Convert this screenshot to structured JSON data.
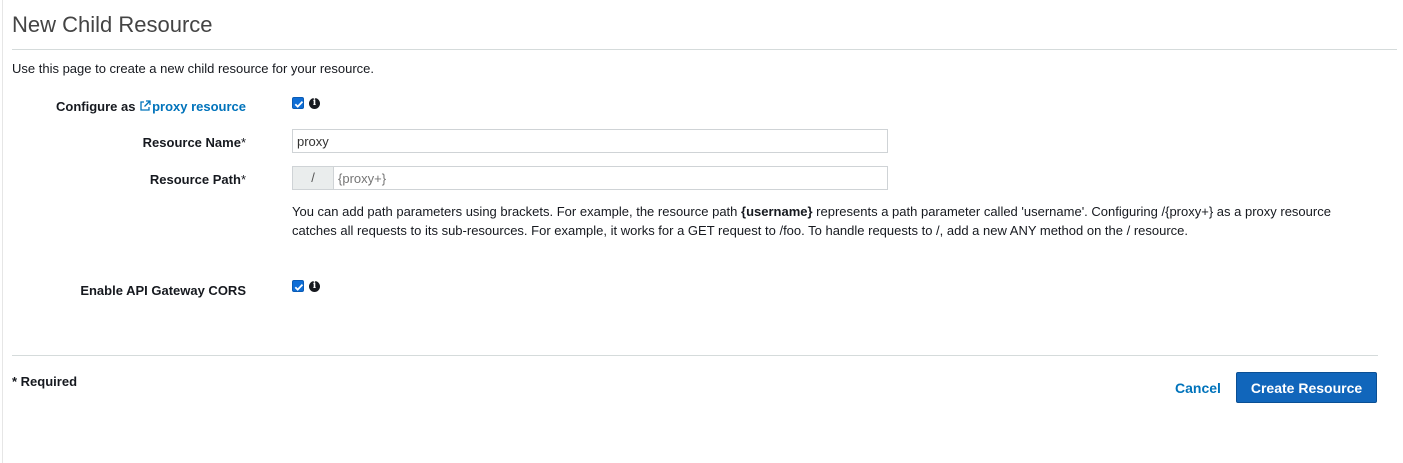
{
  "page": {
    "title": "New Child Resource",
    "intro": "Use this page to create a new child resource for your resource."
  },
  "form": {
    "proxy": {
      "label_prefix": "Configure as ",
      "link_text": "proxy resource",
      "checked": true
    },
    "resource_name": {
      "label": "Resource Name",
      "required_mark": "*",
      "value": "proxy"
    },
    "resource_path": {
      "label": "Resource Path",
      "required_mark": "*",
      "prefix": "/",
      "value": "{proxy+}"
    },
    "help": {
      "part1": "You can add path parameters using brackets. For example, the resource path ",
      "bold": "{username}",
      "part2": " represents a path parameter called 'username'. Configuring /{proxy+} as a proxy resource catches all requests to its sub-resources. For example, it works for a GET request to /foo. To handle requests to /, add a new ANY method on the / resource."
    },
    "cors": {
      "label": "Enable API Gateway CORS",
      "checked": true
    }
  },
  "footer": {
    "required_note": "* Required",
    "cancel_label": "Cancel",
    "create_label": "Create Resource"
  },
  "colors": {
    "link": "#0073bb",
    "primary_button": "#1166bb",
    "checkbox": "#0f6ed6"
  },
  "icons": [
    "external-link-icon",
    "info-icon",
    "checkbox-checked-icon"
  ]
}
